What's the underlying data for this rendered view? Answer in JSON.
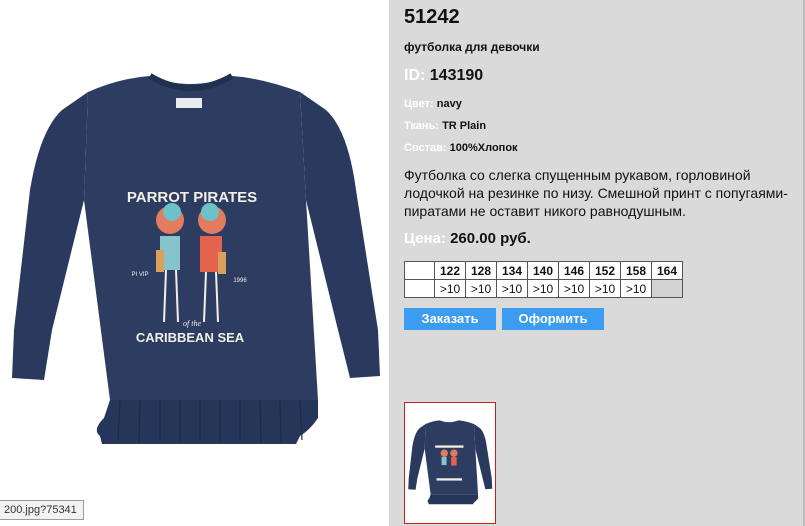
{
  "product": {
    "article": "51242",
    "subtitle": "футболка для девочки",
    "id_label": "ID:",
    "id_value": "143190",
    "color_label": "Цвет:",
    "color_value": "navy",
    "fabric_label": "Ткань:",
    "fabric_value": "TR Plain",
    "composition_label": "Состав:",
    "composition_value": "100%Хлопок",
    "description": "Футболка со слегка спущенным рукавом, горловиной лодочкой на резинке по низу. Смешной принт с попугаями-пиратами не оставит никого равнодушным.",
    "price_label": "Цена:",
    "price_value": "260.00 руб."
  },
  "sizes": {
    "headers": [
      "",
      "122",
      "128",
      "134",
      "140",
      "146",
      "152",
      "158",
      "164"
    ],
    "stock": [
      "",
      ">10",
      ">10",
      ">10",
      ">10",
      ">10",
      ">10",
      ">10",
      ""
    ]
  },
  "buttons": {
    "order": "Заказать",
    "checkout": "Оформить"
  },
  "image": {
    "print_top": "PARROT PIRATES",
    "print_left": "PI VIP",
    "print_right": "1996",
    "print_of": "of the",
    "print_bottom": "CARIBBEAN SEA"
  },
  "status_url": "200.jpg?75341",
  "colors": {
    "panel": "#dadada",
    "button": "#3b9cf0",
    "shirt": "#2b3a5f",
    "thumb_border": "#c62020"
  }
}
